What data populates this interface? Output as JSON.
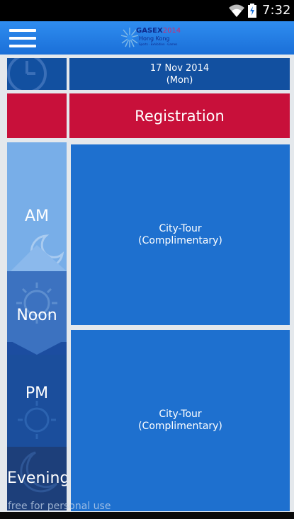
{
  "status_bar": {
    "time": "7:32"
  },
  "app_bar": {
    "logo": {
      "name": "GASEX",
      "year": "2014",
      "city": "Hong Kong",
      "tagline": "Sports · Exhibition · Games"
    }
  },
  "schedule": {
    "date": "17 Nov 2014",
    "weekday": "(Mon)",
    "registration_label": "Registration",
    "periods": [
      "AM",
      "Noon",
      "PM",
      "Evening"
    ],
    "events": [
      {
        "title": "City-Tour",
        "note": "(Complimentary)"
      },
      {
        "title": "City-Tour",
        "note": "(Complimentary)"
      }
    ]
  },
  "watermark": "free for personal use",
  "colors": {
    "app_bar": "#2f8df0",
    "header_cell": "#1250a0",
    "registration": "#c8103a",
    "event_cell": "#1e70cf"
  }
}
